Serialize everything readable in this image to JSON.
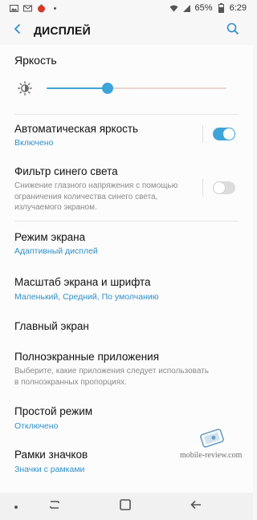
{
  "status_bar": {
    "battery_percent": "65%",
    "time": "6:29"
  },
  "appbar": {
    "title": "ДИСПЛЕЙ"
  },
  "brightness": {
    "label": "Яркость",
    "level": 0.34
  },
  "items": [
    {
      "title": "Автоматическая яркость",
      "sub": "Включено",
      "toggle": "on"
    },
    {
      "title": "Фильтр синего света",
      "desc": "Снижение глазного напряжения с помощью ограничения количества синего света, излучаемого экраном.",
      "toggle": "off"
    },
    {
      "title": "Режим экрана",
      "sub": "Адаптивный дисплей"
    },
    {
      "title": "Масштаб экрана и шрифта",
      "sub": "Маленький, Средний, По умолчанию"
    },
    {
      "title": "Главный экран"
    },
    {
      "title": "Полноэкранные приложения",
      "desc": "Выберите, какие приложения следует использовать в полноэкранных пропорциях."
    },
    {
      "title": "Простой режим",
      "sub": "Отключено"
    },
    {
      "title": "Рамки значков",
      "sub": "Значки с рамками"
    }
  ],
  "watermark": {
    "text": "mobile-review.com"
  },
  "colors": {
    "accent": "#3ea4d8",
    "subtitle": "#2f8fc7"
  }
}
